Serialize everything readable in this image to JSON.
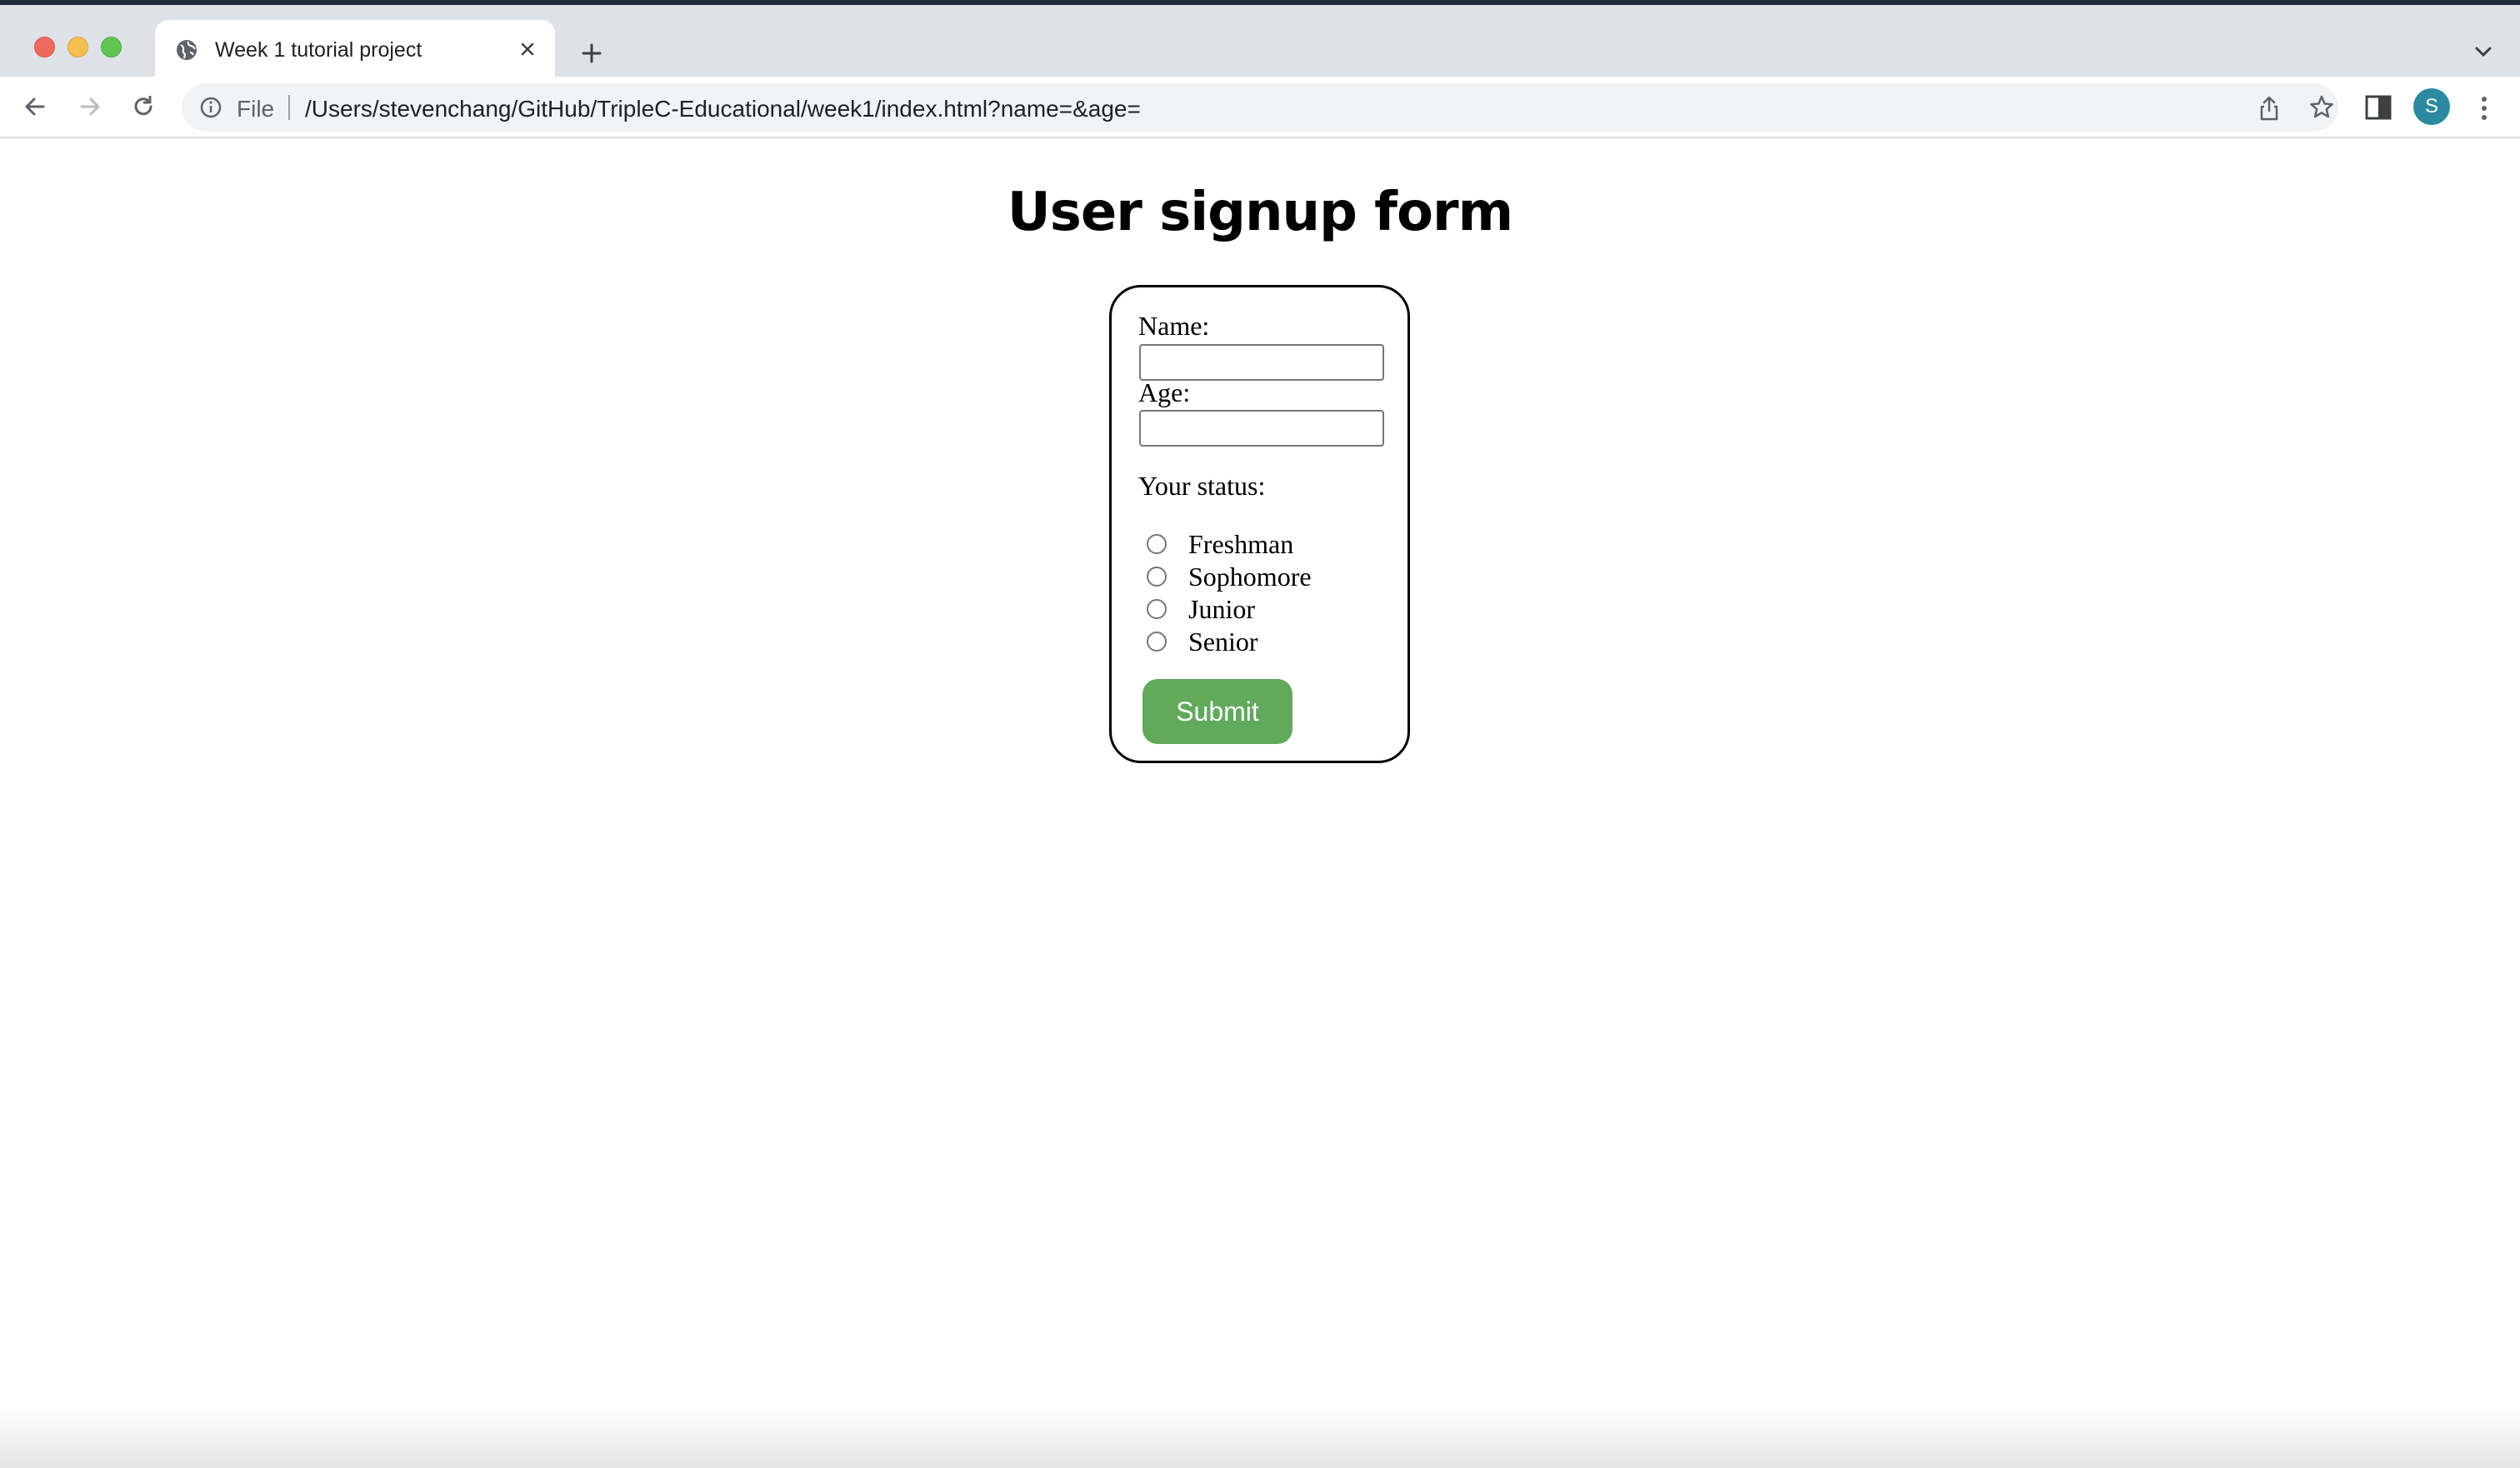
{
  "browser": {
    "tab_title": "Week 1 tutorial project",
    "omnibox": {
      "scheme_label": "File",
      "url": "/Users/stevenchang/GitHub/TripleC-Educational/week1/index.html?name=&age="
    },
    "profile_initial": "S",
    "icons": [
      "globe-icon",
      "close-icon",
      "plus-icon",
      "chevron-down-icon",
      "back-arrow-icon",
      "forward-arrow-icon",
      "reload-icon",
      "info-icon",
      "share-icon",
      "star-icon",
      "side-panel-icon",
      "kebab-menu-icon"
    ]
  },
  "page": {
    "title": "User signup form",
    "form": {
      "name_label": "Name:",
      "name_value": "",
      "age_label": "Age:",
      "age_value": "",
      "status_label": "Your status:",
      "status_options": [
        {
          "label": "Freshman",
          "selected": false
        },
        {
          "label": "Sophomore",
          "selected": false
        },
        {
          "label": "Junior",
          "selected": false
        },
        {
          "label": "Senior",
          "selected": false
        }
      ],
      "submit_label": "Submit"
    }
  },
  "colors": {
    "submit_button": "#61a95b",
    "avatar": "#2b8a9f",
    "tabstrip": "#dee1e6"
  }
}
